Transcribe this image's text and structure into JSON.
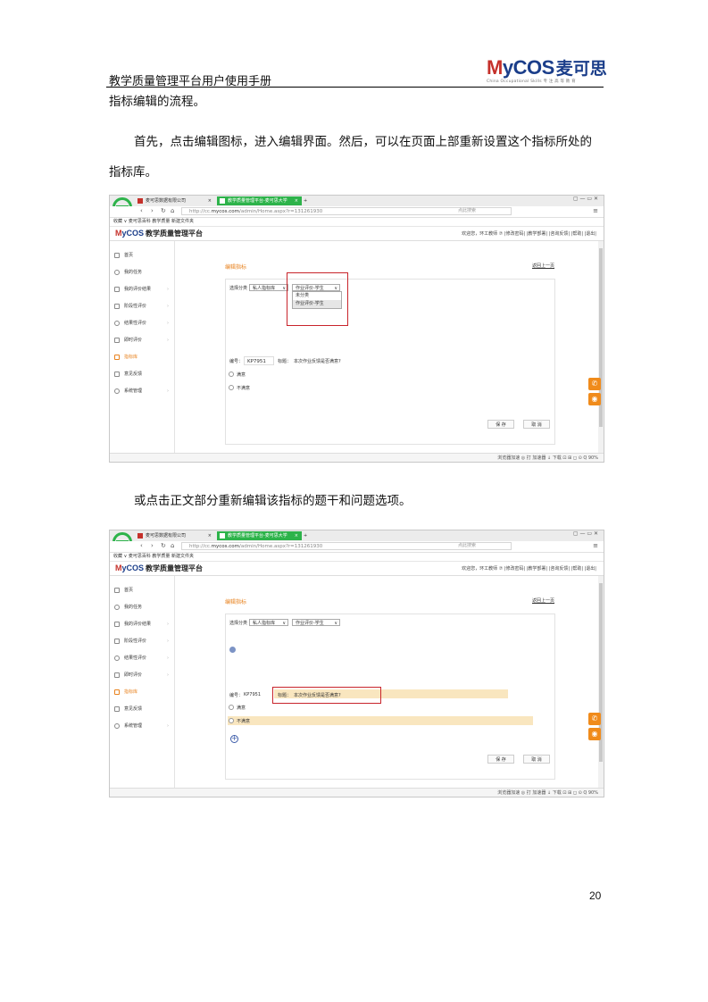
{
  "doc": {
    "header_title": "教学质量管理平台用户使用手册",
    "logo_text": "MyCOS",
    "logo_cn": "麦可思",
    "logo_tagline": "China Occupational Skills  专 注 高 等 教 育",
    "paragraph1": "指标编辑的流程。",
    "paragraph2_line1": "首先，点击编辑图标，进入编辑界面。然后，可以在页面上部重新设置这个指标所处的",
    "paragraph2_line2": "指标库。",
    "paragraph3": "或点击正文部分重新编辑该指标的题干和问题选项。",
    "page_number": "20"
  },
  "browser": {
    "tab1": "麦可思数据有限公司",
    "tab2": "教学质量管理平台-麦可思大学",
    "tab_new": "+",
    "url_prefix": "http://cc.",
    "url_domain": "mycos.com",
    "url_path": "/admin/Home.aspx?r=131261930",
    "search_placeholder": "点此搜索",
    "bookmarks": "收藏 ∨   麦可思百科   教学质量   新建文件夹",
    "status_bar": "浏览器加速   ◎   打 加速器   ↓ 下载   ⊡   ⊞   ◻   ⊙   Q 90%"
  },
  "app": {
    "logo": "MyCOS",
    "title": "教学质量管理平台",
    "user_bar": "欢迎您，环工教师 ⑦  |修改密码| |教学部署| |咨询反馈| |帮助| |退出|",
    "sidebar": [
      "首页",
      "我的任务",
      "我的评价结果",
      "阶段性评价",
      "结果性评价",
      "即时评价",
      "指标库",
      "意见反馈",
      "系统管理"
    ],
    "active_item": "指标库",
    "edit_title": "编辑指标",
    "back_link": "返回上一页",
    "select_label": "选择分类",
    "select1": "私人指标库",
    "select2": "作业评价-学生",
    "dropdown_options": [
      "未分类",
      "作业评价-学生"
    ],
    "code_label": "编号：",
    "code_value": "KP7951",
    "question_label": "标题：",
    "question_text": "本次作业反馈是否满意?",
    "options": [
      "满意",
      "不满意"
    ],
    "save_button": "保 存",
    "cancel_button": "取 消"
  }
}
